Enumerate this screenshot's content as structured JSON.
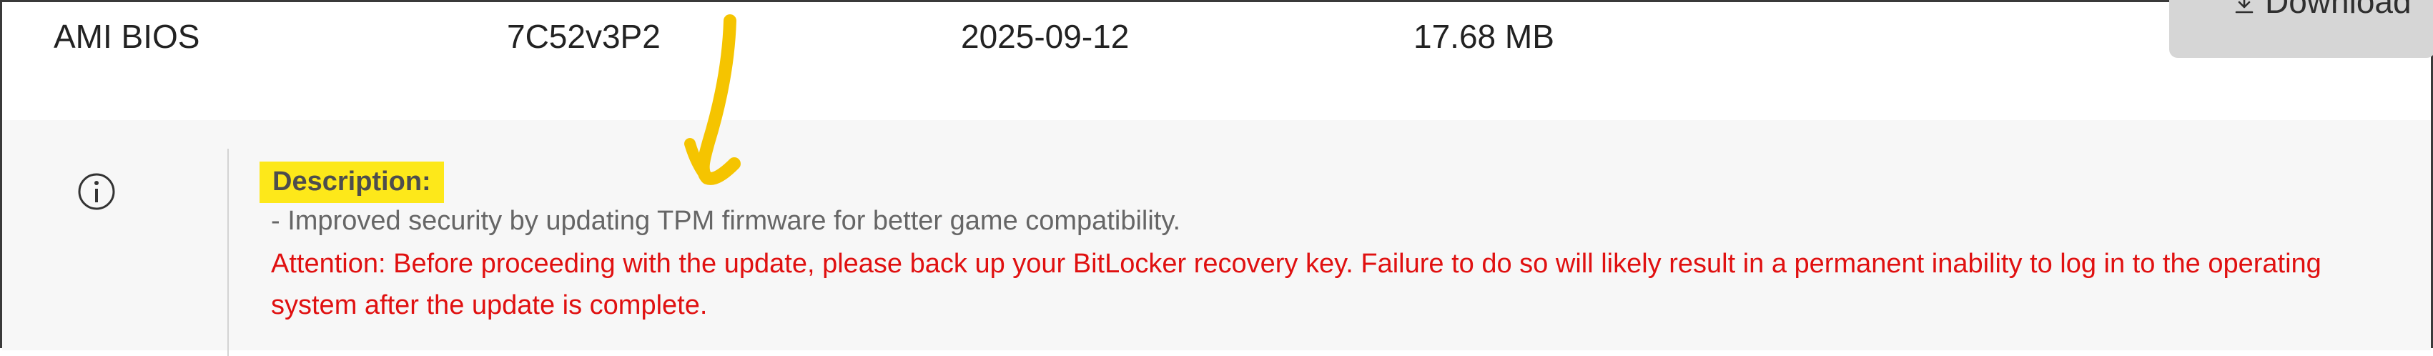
{
  "bios_row": {
    "name": "AMI BIOS",
    "version": "7C52v3P2",
    "date": "2025-09-12",
    "size": "17.68 MB",
    "download_label": "Download"
  },
  "description": {
    "label": "Description:",
    "improvement": "- Improved security by updating TPM firmware for better game compatibility.",
    "attention": "Attention: Before proceeding with the update, please back up your BitLocker recovery key. Failure to do so will likely result in a permanent inability to log in to the operating system after the update is complete."
  },
  "colors": {
    "highlight": "#fde81a",
    "attention": "#e01010",
    "annotation": "#f5c400"
  },
  "icons": {
    "info": "info-circle-icon",
    "download": "download-icon",
    "annotation": "hand-drawn-arrow"
  }
}
